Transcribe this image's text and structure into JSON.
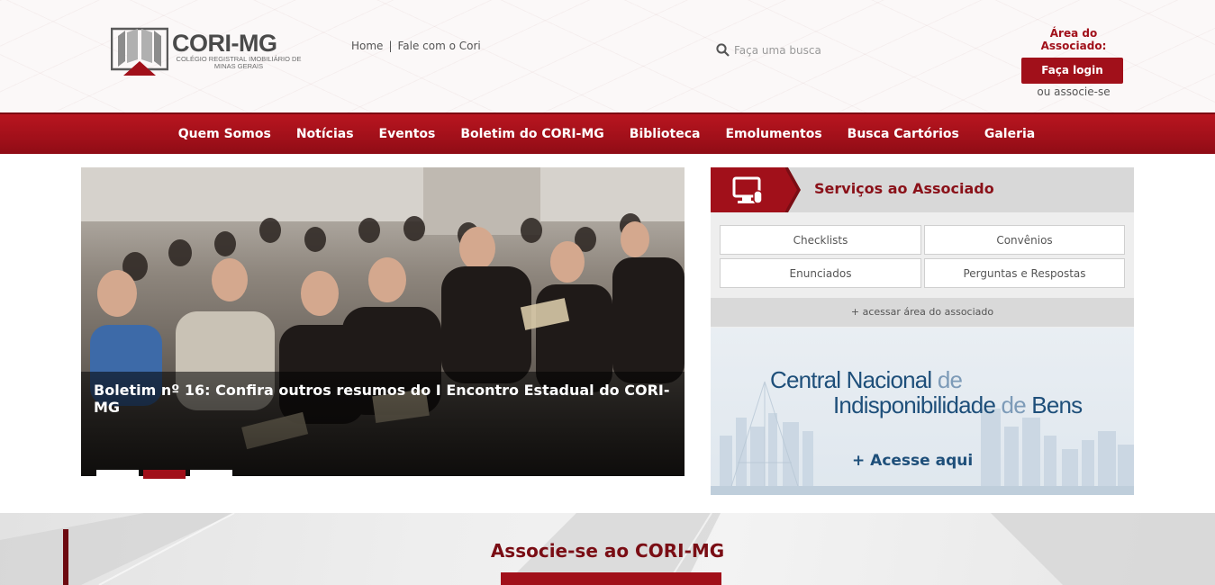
{
  "header": {
    "logo": {
      "title": "CORI-MG",
      "subtitle": "Colégio Registral Imobiliário de Minas Gerais"
    },
    "toplinks": {
      "home": "Home",
      "separator": "|",
      "contact": "Fale com o Cori"
    },
    "search": {
      "placeholder": "Faça uma busca"
    },
    "associate": {
      "title": "Área do Associado:",
      "login": "Faça login",
      "join": "ou associe-se"
    }
  },
  "nav": {
    "items": [
      "Quem Somos",
      "Notícias",
      "Eventos",
      "Boletim do CORI-MG",
      "Biblioteca",
      "Emolumentos",
      "Busca Cartórios",
      "Galeria"
    ]
  },
  "slider": {
    "caption": "Boletim nº 16: Confira outros resumos do I Encontro Estadual do CORI-MG",
    "total_slides": 3,
    "active_slide": 2
  },
  "services": {
    "title": "Serviços ao Associado",
    "buttons": [
      "Checklists",
      "Convênios",
      "Enunciados",
      "Perguntas e Respostas"
    ],
    "more": "+ acessar área do associado"
  },
  "cnib": {
    "line1_a": "Central Nacional",
    "line1_b": " de",
    "line2_a": "Indisponibilidade",
    "line2_b": " de ",
    "line2_c": "Bens",
    "cta": "+ Acesse aqui"
  },
  "bottom": {
    "title": "Associe-se ao CORI-MG"
  },
  "colors": {
    "brand": "#a1101a",
    "brand_dark": "#7a0d14",
    "cnib_blue": "#1e4f7a"
  }
}
